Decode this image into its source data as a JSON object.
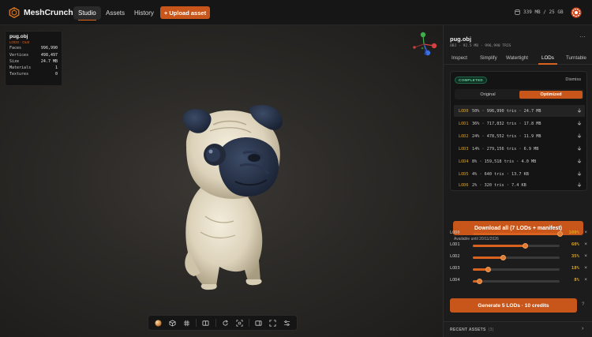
{
  "app": {
    "name": "MeshCrunch"
  },
  "nav": {
    "items": [
      "Studio",
      "Assets",
      "History"
    ],
    "active": "Studio",
    "upload_label": "+ Upload asset"
  },
  "storage": {
    "text": "339 MB / 25 GB"
  },
  "stats": {
    "filename": "pug.obj",
    "subtitle": "LOD0 · OLB",
    "rows": [
      {
        "label": "Faces",
        "value": "996,990"
      },
      {
        "label": "Vertices",
        "value": "498,497"
      },
      {
        "label": "Size",
        "value": "24.7 MB"
      },
      {
        "label": "Materials",
        "value": "1"
      },
      {
        "label": "Textures",
        "value": "0"
      }
    ]
  },
  "panel": {
    "title": "pug.obj",
    "subtitle": "OBJ · 92.5 MB · 996,990 TRIS",
    "more": "···",
    "tabs": [
      "Inspect",
      "Simplify",
      "Watertight",
      "LODs",
      "Turntable"
    ],
    "active_tab": "LODs",
    "result": {
      "badge": "COMPLETED",
      "dismiss": "Dismiss",
      "segments": [
        "Original",
        "Optimized"
      ],
      "active_segment": "Optimized",
      "lods": [
        {
          "name": "LOD0",
          "info": "50% · 996,990 tris · 24.7 MB"
        },
        {
          "name": "LOD1",
          "info": "36% · 717,832 tris · 17.8 MB"
        },
        {
          "name": "LOD2",
          "info": "24% · 478,552 tris · 11.9 MB"
        },
        {
          "name": "LOD3",
          "info": "14% · 279,156 tris · 6.9 MB"
        },
        {
          "name": "LOD4",
          "info": "8% · 159,518 tris · 4.0 MB"
        },
        {
          "name": "LOD5",
          "info": "4% · 640 tris · 13.7 KB"
        },
        {
          "name": "LOD6",
          "info": "2% · 320 tris · 7.4 KB"
        }
      ]
    },
    "download_label": "Download all (7 LODs + manifest)",
    "available": "Available until 20/11/2026",
    "sliders": [
      {
        "name": "LOD0",
        "percent": 100,
        "label": "100%"
      },
      {
        "name": "LOD1",
        "percent": 60,
        "label": "60%"
      },
      {
        "name": "LOD2",
        "percent": 35,
        "label": "35%"
      },
      {
        "name": "LOD3",
        "percent": 18,
        "label": "18%"
      },
      {
        "name": "LOD4",
        "percent": 8,
        "label": "8%"
      }
    ],
    "remove_glyph": "×",
    "generate_label": "Generate 5 LODs · 10 credits",
    "help_glyph": "?",
    "recent": {
      "label": "RECENT ASSETS",
      "count": "(3)"
    }
  },
  "colors": {
    "accent": "#c8561a",
    "lod_label": "#e0a31e",
    "success": "#5fd69c"
  }
}
